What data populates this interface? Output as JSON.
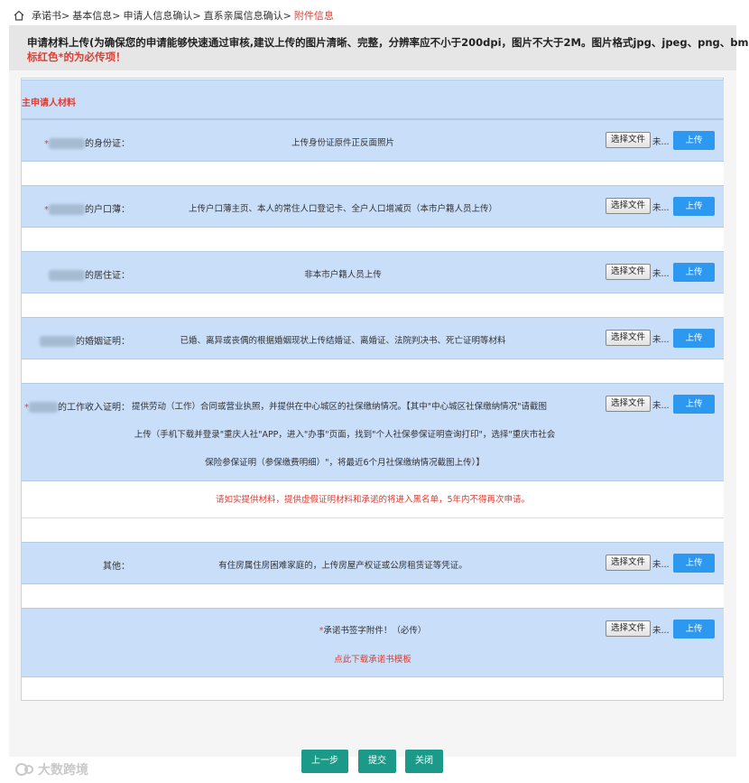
{
  "breadcrumb": {
    "items": [
      "承诺书>",
      "基本信息>",
      "申请人信息确认>",
      "直系亲属信息确认>"
    ],
    "current": "附件信息"
  },
  "notice": {
    "line1": "申请材料上传(为确保您的申请能够快速通过审核,建议上传的图片清晰、完整，分辨率应不小于200dpi，图片不大于2M。图片格式jpg、jpeg、png、bmp)",
    "line2": "标红色*的为必传项！"
  },
  "section_title": "主申请人材料",
  "controls": {
    "choose_file": "选择文件",
    "no_file": "未...",
    "upload": "上传"
  },
  "rows": [
    {
      "required": "*",
      "label": "的身份证：",
      "desc": "上传身份证原件正反面照片"
    },
    {
      "required": "*",
      "label": "的户口薄：",
      "desc": "上传户口薄主页、本人的常住人口登记卡、全户人口增减页（本市户籍人员上传）"
    },
    {
      "required": "",
      "label": "的居住证：",
      "desc": "非本市户籍人员上传"
    },
    {
      "required": "",
      "label": "的婚姻证明：",
      "desc": "已婚、离异或丧偶的根据婚姻现状上传结婚证、离婚证、法院判决书、死亡证明等材料"
    },
    {
      "required": "*",
      "label": "的工作收入证明：",
      "desc_lines": [
        "提供劳动（工作）合同或营业执照，并提供在中心城区的社保缴纳情况。【其中\"中心城区社保缴纳情况\"请截图",
        "上传（手机下载并登录\"重庆人社\"APP，进入\"办事\"页面，找到\"个人社保参保证明查询打印\"，选择\"重庆市社会",
        "保险参保证明（参保缴费明细）\"，将最近6个月社保缴纳情况截图上传）】"
      ]
    },
    {
      "required": "",
      "label": "其他：",
      "desc": "有住房属住房困难家庭的，上传房屋产权证或公房租赁证等凭证。"
    }
  ],
  "warning": "请如实提供材料，提供虚假证明材料和承诺的将进入黑名单，5年内不得再次申请。",
  "signature": {
    "required": "*",
    "text": "承诺书签字附件！（必传）",
    "download_link": "点此下载承诺书模板"
  },
  "actions": {
    "prev": "上一步",
    "submit": "提交",
    "close": "关闭"
  },
  "watermark": "大数跨境"
}
